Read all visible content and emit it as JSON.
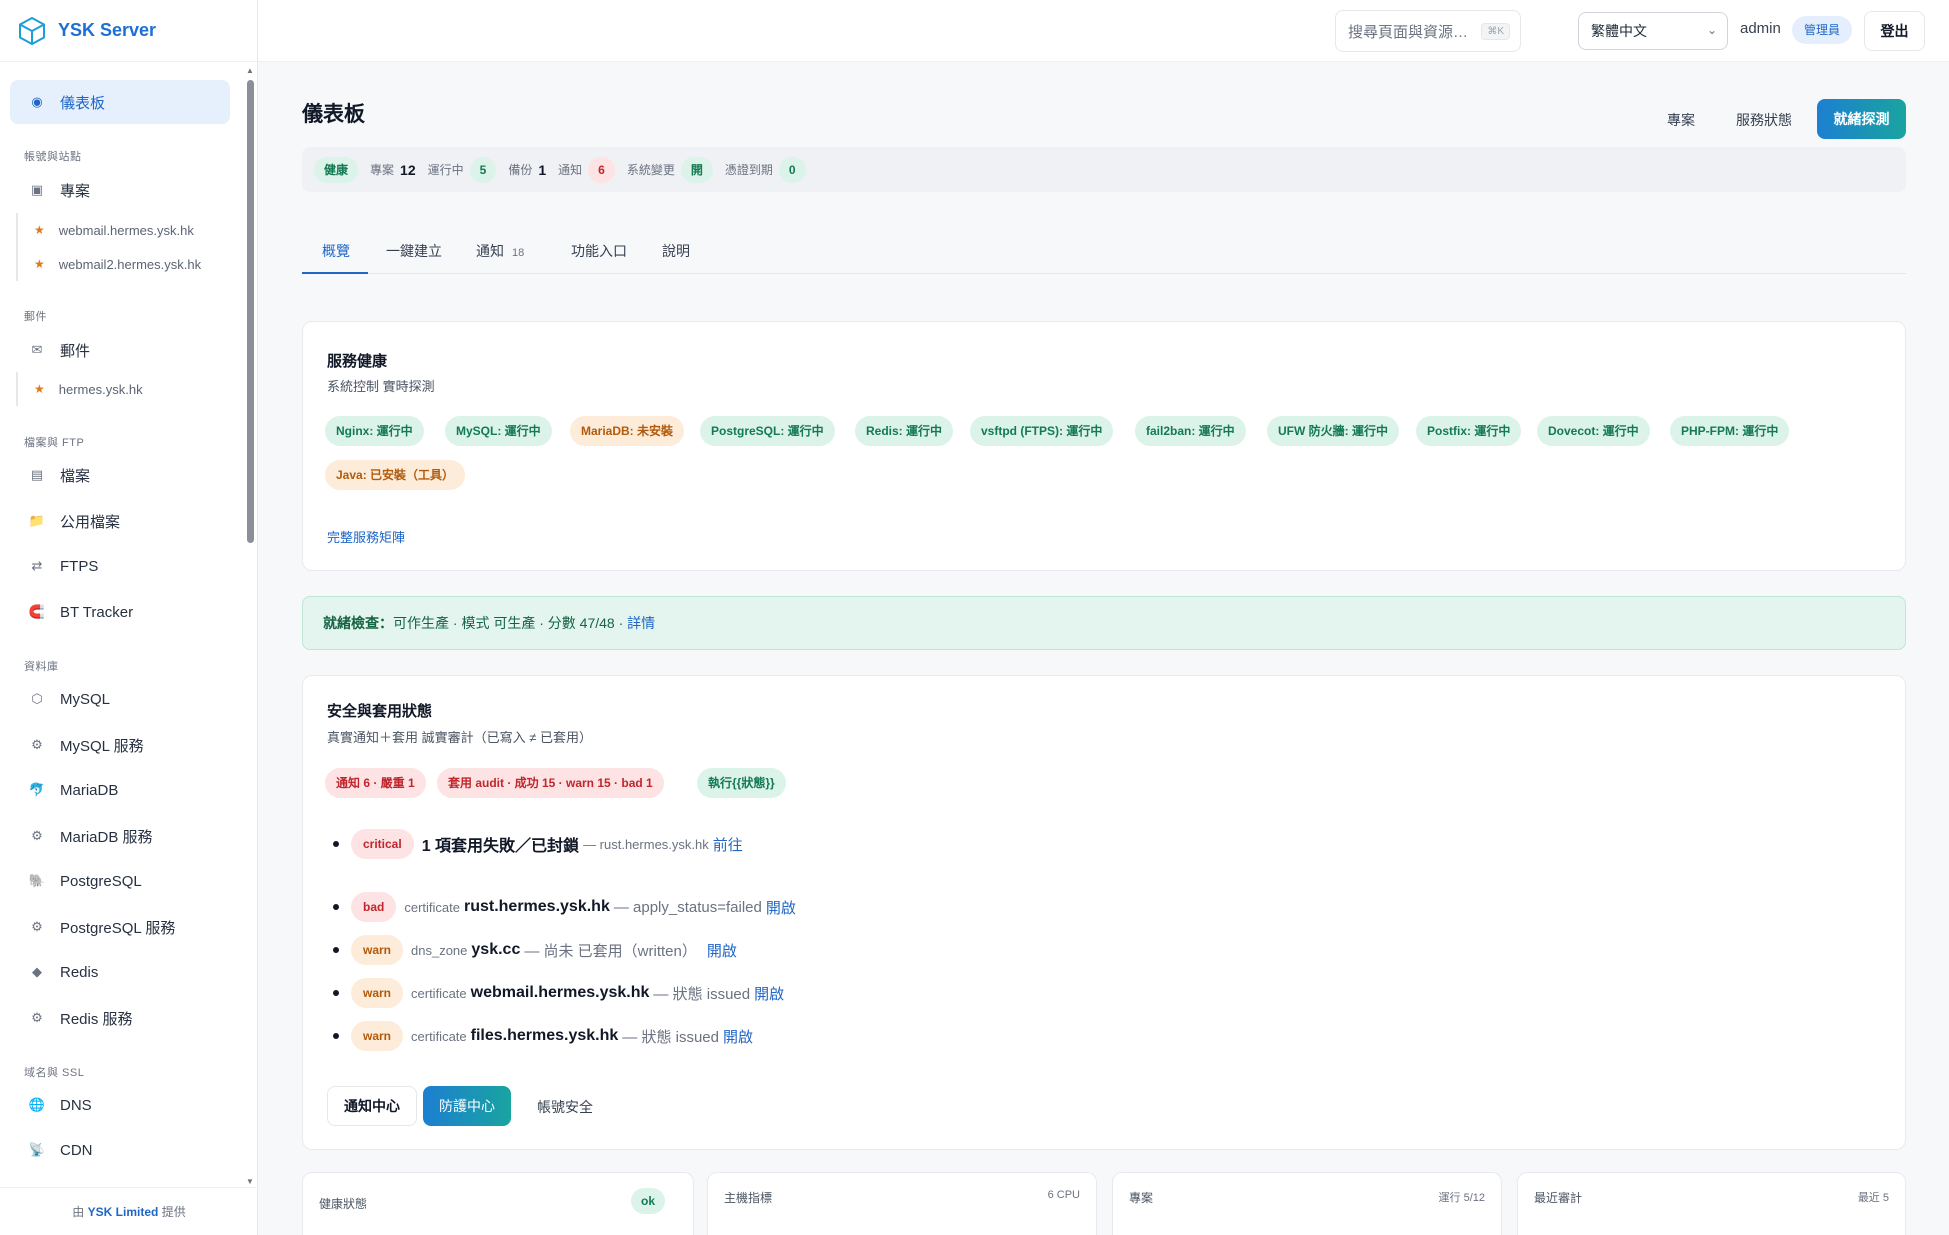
{
  "brand": {
    "name": "YSK Server"
  },
  "sidebar": {
    "items": [
      {
        "label": "儀表板",
        "icon": "◉"
      },
      {
        "group": "帳號與站點"
      },
      {
        "label": "專案",
        "icon": "▣"
      },
      {
        "sub": "webmail.hermes.ysk.hk"
      },
      {
        "sub": "webmail2.hermes.ysk.hk"
      },
      {
        "group": "郵件"
      },
      {
        "label": "郵件",
        "icon": "✉"
      },
      {
        "sub": "hermes.ysk.hk"
      },
      {
        "group": "檔案與 FTP"
      },
      {
        "label": "檔案",
        "icon": "▤"
      },
      {
        "label": "公用檔案",
        "icon": "📁"
      },
      {
        "label": "FTPS",
        "icon": "⇄"
      },
      {
        "label": "BT Tracker",
        "icon": "🧲"
      },
      {
        "group": "資料庫"
      },
      {
        "label": "MySQL",
        "icon": "⬡"
      },
      {
        "label": "MySQL 服務",
        "icon": "⚙"
      },
      {
        "label": "MariaDB",
        "icon": "🐬"
      },
      {
        "label": "MariaDB 服務",
        "icon": "⚙"
      },
      {
        "label": "PostgreSQL",
        "icon": "🐘"
      },
      {
        "label": "PostgreSQL 服務",
        "icon": "⚙"
      },
      {
        "label": "Redis",
        "icon": "◆"
      },
      {
        "label": "Redis 服務",
        "icon": "⚙"
      },
      {
        "group": "域名與 SSL"
      },
      {
        "label": "DNS",
        "icon": "🌐"
      },
      {
        "label": "CDN",
        "icon": "📡"
      }
    ],
    "footer_prefix": "由",
    "footer_brand": "YSK Limited",
    "footer_suffix": "提供"
  },
  "topbar": {
    "search_placeholder": "搜尋頁面與資源…",
    "search_kbd": "⌘K",
    "language": "繁體中文",
    "user": "admin",
    "role": "管理員",
    "logout": "登出"
  },
  "header": {
    "title": "儀表板",
    "btn_projects": "專案",
    "btn_service_status": "服務狀態",
    "btn_readiness": "就緒探測"
  },
  "statusbar": {
    "health": "健康",
    "projects_label": "專案",
    "projects_value": "12",
    "running_label": "運行中",
    "running_value": "5",
    "backup_label": "備份",
    "backup_value": "1",
    "notify_label": "通知",
    "notify_value": "6",
    "sysdiff_label": "系統變更",
    "sysdiff_value": "開",
    "cert_label": "憑證到期",
    "cert_value": "0"
  },
  "tabs": [
    {
      "label": "概覽"
    },
    {
      "label": "一鍵建立"
    },
    {
      "label": "通知",
      "count": "18"
    },
    {
      "label": "功能入口"
    },
    {
      "label": "說明"
    }
  ],
  "service_health": {
    "title": "服務健康",
    "subtitle": "系統控制 實時探測",
    "chips": [
      {
        "text": "Nginx: 運行中",
        "tone": "green"
      },
      {
        "text": "MySQL: 運行中",
        "tone": "green"
      },
      {
        "text": "MariaDB: 未安裝",
        "tone": "orange"
      },
      {
        "text": "PostgreSQL: 運行中",
        "tone": "green"
      },
      {
        "text": "Redis: 運行中",
        "tone": "green"
      },
      {
        "text": "vsftpd (FTPS): 運行中",
        "tone": "green"
      },
      {
        "text": "fail2ban: 運行中",
        "tone": "green"
      },
      {
        "text": "UFW 防火牆: 運行中",
        "tone": "green"
      },
      {
        "text": "Postfix: 運行中",
        "tone": "green"
      },
      {
        "text": "Dovecot: 運行中",
        "tone": "green"
      },
      {
        "text": "PHP-FPM: 運行中",
        "tone": "green"
      },
      {
        "text": "Java: 已安裝（工具）",
        "tone": "orange"
      }
    ],
    "link": "完整服務矩陣"
  },
  "readiness": {
    "label": "就緒檢查：",
    "text": "可作生產 · 模式 可生產 · 分數 47/48 ·",
    "link": "詳情"
  },
  "security": {
    "title": "安全與套用狀態",
    "subtitle": "真實通知＋套用 誠實審計（已寫入 ≠ 已套用）",
    "pills": [
      {
        "text": "通知 6 · 嚴重 1",
        "tone": "red"
      },
      {
        "text": "套用 audit · 成功 15 · warn 15 · bad 1",
        "tone": "red"
      },
      {
        "text": "執行{{狀態}}",
        "tone": "green"
      }
    ],
    "issues": [
      {
        "sev": "critical",
        "sev_class": "crit",
        "kind": "",
        "target": "1 項套用失敗／已封鎖",
        "detail": "— rust.hermes.ysk.hk",
        "action": "前往"
      },
      {
        "sev": "bad",
        "sev_class": "bad",
        "kind": "certificate",
        "target": "rust.hermes.ysk.hk",
        "detail": "— apply_status=failed",
        "action": "開啟"
      },
      {
        "sev": "warn",
        "sev_class": "warn",
        "kind": "dns_zone",
        "target": "ysk.cc",
        "detail": "— 尚未 已套用（written）",
        "action": "開啟"
      },
      {
        "sev": "warn",
        "sev_class": "warn",
        "kind": "certificate",
        "target": "webmail.hermes.ysk.hk",
        "detail": "— 狀態 issued",
        "action": "開啟"
      },
      {
        "sev": "warn",
        "sev_class": "warn",
        "kind": "certificate",
        "target": "files.hermes.ysk.hk",
        "detail": "— 狀態 issued",
        "action": "開啟"
      }
    ],
    "btn_notify_center": "通知中心",
    "btn_protect_center": "防護中心",
    "btn_account_security": "帳號安全"
  },
  "mini_cards": [
    {
      "title": "健康狀態",
      "meta": "",
      "pill": "ok"
    },
    {
      "title": "主機指標",
      "meta": "6 CPU",
      "pill": ""
    },
    {
      "title": "專案",
      "meta": "運行 5/12",
      "pill": ""
    },
    {
      "title": "最近審計",
      "meta": "最近 5",
      "pill": ""
    }
  ]
}
